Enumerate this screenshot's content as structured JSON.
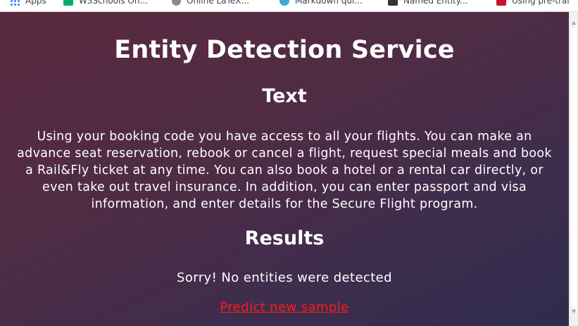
{
  "bookmarks": [
    {
      "label": "Apps",
      "icon": "apps-grid-icon"
    },
    {
      "label": "W3Schools On...",
      "icon": "w3schools-icon"
    },
    {
      "label": "Online LaTeX...",
      "icon": "gear-icon"
    },
    {
      "label": "Markdown qui...",
      "icon": "markdown-icon"
    },
    {
      "label": "Named Entity...",
      "icon": "named-entity-icon"
    },
    {
      "label": "Using pre-trai",
      "icon": "r-icon"
    }
  ],
  "page": {
    "title": "Entity Detection Service",
    "text_heading": "Text",
    "body_text": "Using your booking code you have access to all your flights. You can make an advance seat reservation, rebook or cancel a flight, request special meals and book a Rail&Fly ticket at any time. You can also book a hotel or a rental car directly, or even take out travel insurance. In addition, you can enter passport and visa information, and enter details for the Secure Flight program.",
    "results_heading": "Results",
    "result_message": "Sorry! No entities were detected",
    "predict_link": "Predict new sample"
  },
  "colors": {
    "gradient_start": "#5b2a3f",
    "gradient_end": "#2f2c4e",
    "link": "#ff1a1a",
    "text": "#ffffff"
  }
}
